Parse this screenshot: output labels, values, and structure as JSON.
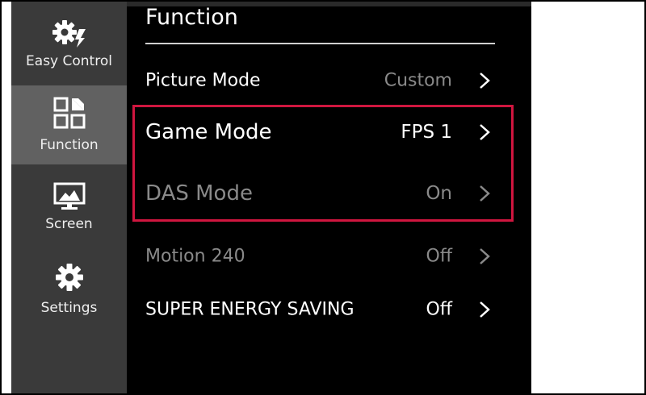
{
  "sidebar": {
    "items": [
      {
        "label": "Easy Control",
        "icon": "easy-control-gear-icon",
        "active": false
      },
      {
        "label": "Function",
        "icon": "function-grid-icon",
        "active": true
      },
      {
        "label": "Screen",
        "icon": "screen-monitor-icon",
        "active": false
      },
      {
        "label": "Settings",
        "icon": "settings-gear-icon",
        "active": false
      }
    ]
  },
  "main": {
    "title": "Function",
    "rows": [
      {
        "label": "Picture Mode",
        "value": "Custom",
        "dim_label": false,
        "dim_value": true
      },
      {
        "label": "Game Mode",
        "value": "FPS 1",
        "dim_label": false,
        "dim_value": false
      },
      {
        "label": "DAS Mode",
        "value": "On",
        "dim_label": true,
        "dim_value": true
      },
      {
        "label": "Motion 240",
        "value": "Off",
        "dim_label": true,
        "dim_value": true
      },
      {
        "label": "SUPER ENERGY SAVING",
        "value": "Off",
        "dim_label": false,
        "dim_value": false
      }
    ]
  },
  "colors": {
    "highlight": "#d0163f",
    "sidebar_bg": "#3a3a3a",
    "sidebar_active": "#616161",
    "screen_bg": "#000000",
    "dim_text": "#8a8a8a"
  }
}
